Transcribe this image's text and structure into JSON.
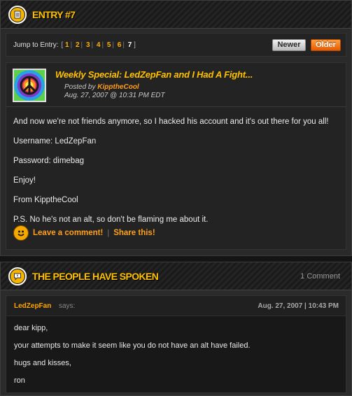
{
  "entry": {
    "header_title": "ENTRY #7",
    "jump_label": "Jump to Entry:",
    "jump_open": "[",
    "jump_close": "]",
    "jump_links": [
      "1",
      "2",
      "3",
      "4",
      "5",
      "6",
      "7"
    ],
    "current_entry": "7",
    "newer_label": "Newer",
    "older_label": "Older",
    "post": {
      "title": "Weekly Special: LedZepFan and I Had A Fight...",
      "posted_by_prefix": "Posted by",
      "author": "KipptheCool",
      "date": "Aug. 27, 2007 @ 10:31 PM EDT",
      "paragraphs": [
        "And now we're not friends anymore, so I hacked his account and it's out there for you all!",
        "Username: LedZepFan",
        "Password: dimebag",
        "Enjoy!",
        "From KipptheCool",
        "P.S. No he's not an alt, so don't be flaming me about it."
      ],
      "comment_link": "Leave a comment!",
      "share_link": "Share this!",
      "action_separator": "|"
    }
  },
  "comments": {
    "header_title": "THE PEOPLE HAVE SPOKEN",
    "count": "1 Comment",
    "items": [
      {
        "author": "LedZepFan",
        "says": "says:",
        "date": "Aug. 27, 2007 | 10:43 PM",
        "lines": [
          "dear kipp,",
          "your attempts to make it seem like you do not have an alt have failed.",
          "hugs and kisses,",
          "ron"
        ]
      }
    ]
  },
  "colors": {
    "accent": "#ffc000",
    "link": "#ffa01a",
    "older_button": "#ff7a1a",
    "background": "#141414"
  },
  "icons": {
    "entry_header": "document-icon",
    "comments_header": "speech-bubble-icon",
    "avatar": "peace-sign-icon",
    "actions": "smiley-icon"
  }
}
